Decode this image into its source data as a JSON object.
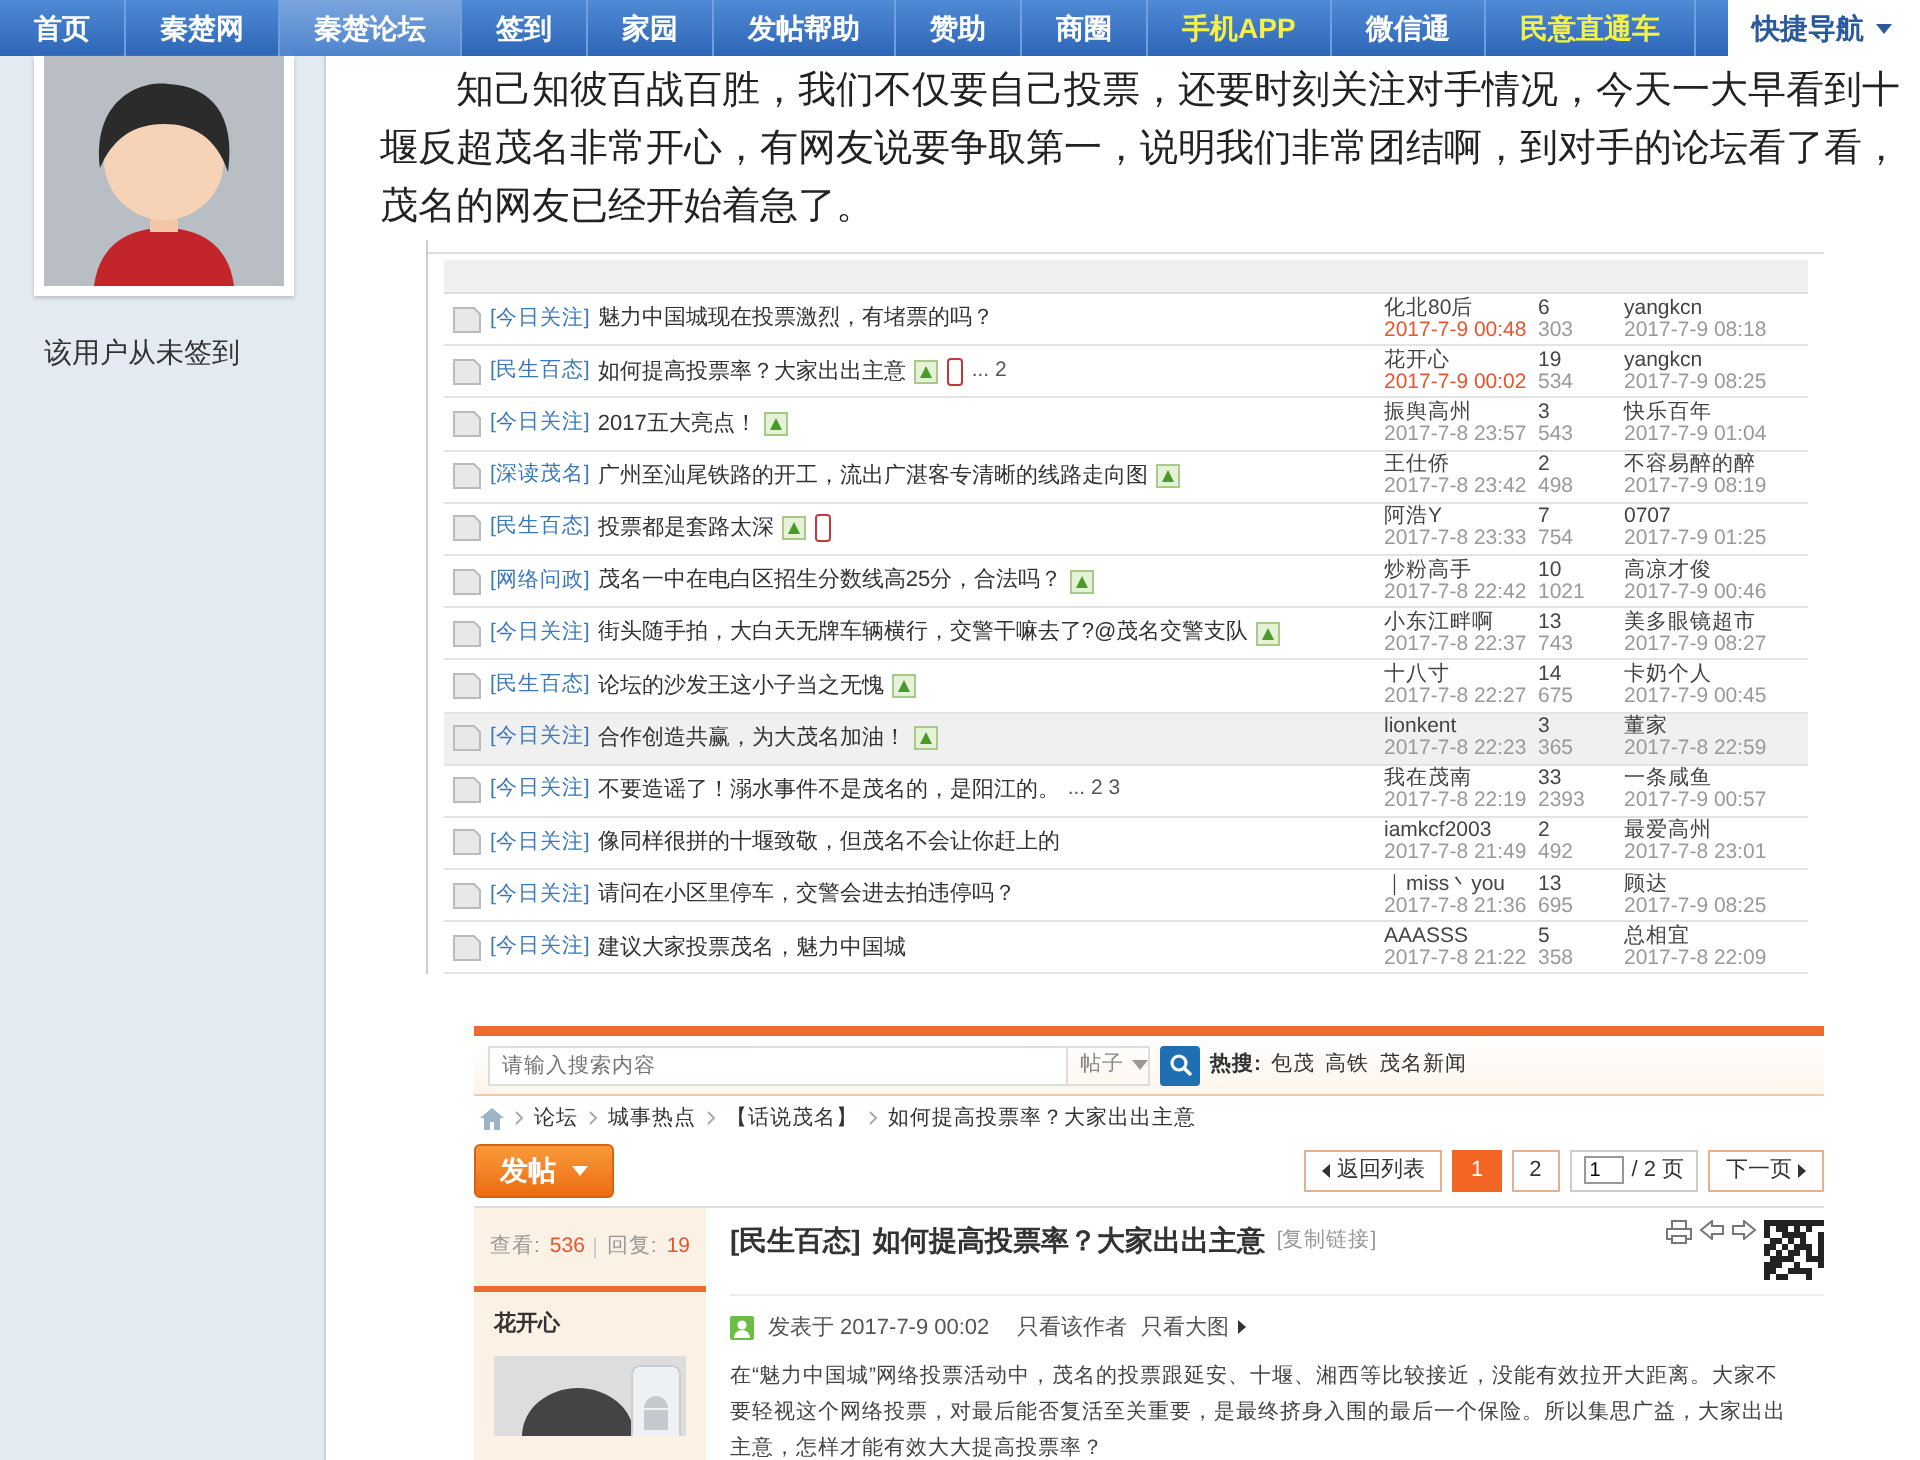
{
  "nav": {
    "items": [
      {
        "label": "首页",
        "selected": false,
        "kind": "normal"
      },
      {
        "label": "秦楚网",
        "selected": false,
        "kind": "normal"
      },
      {
        "label": "秦楚论坛",
        "selected": true,
        "kind": "normal"
      },
      {
        "label": "签到",
        "selected": false,
        "kind": "normal"
      },
      {
        "label": "家园",
        "selected": false,
        "kind": "normal"
      },
      {
        "label": "发帖帮助",
        "selected": false,
        "kind": "normal"
      },
      {
        "label": "赞助",
        "selected": false,
        "kind": "normal"
      },
      {
        "label": "商圈",
        "selected": false,
        "kind": "normal"
      },
      {
        "label": "手机APP",
        "selected": false,
        "kind": "promo"
      },
      {
        "label": "微信通",
        "selected": false,
        "kind": "normal"
      },
      {
        "label": "民意直通车",
        "selected": false,
        "kind": "promo"
      }
    ],
    "quick_nav": "快捷导航"
  },
  "sidebar": {
    "signin_status": "该用户从未签到"
  },
  "post": {
    "paragraph": "知己知彼百战百胜，我们不仅要自己投票，还要时刻关注对手情况，今天一大早看到十堰反超茂名非常开心，有网友说要争取第一，说明我们非常团结啊，到对手的论坛看了看，茂名的网友已经开始着急了。"
  },
  "forum_list_shot": {
    "threads": [
      {
        "tag": "[今日关注]",
        "title": "魅力中国城现在投票激烈，有堵票的吗？",
        "image": false,
        "mobile": false,
        "author": "化北80后",
        "date": "2017-7-9 00:48",
        "new": true,
        "replies": "6",
        "views": "303",
        "last_user": "yangkcn",
        "last_date": "2017-7-9 08:18",
        "selected": false
      },
      {
        "tag": "[民生百态]",
        "title": "如何提高投票率？大家出出主意",
        "image": true,
        "mobile": true,
        "pages": "... 2",
        "author": "花开心",
        "date": "2017-7-9 00:02",
        "new": true,
        "replies": "19",
        "views": "534",
        "last_user": "yangkcn",
        "last_date": "2017-7-9 08:25",
        "selected": false
      },
      {
        "tag": "[今日关注]",
        "title": "2017五大亮点！",
        "image": true,
        "mobile": false,
        "author": "振舆高州",
        "date": "2017-7-8 23:57",
        "new": false,
        "replies": "3",
        "views": "543",
        "last_user": "快乐百年",
        "last_date": "2017-7-9 01:04",
        "selected": false
      },
      {
        "tag": "[深读茂名]",
        "title": "广州至汕尾铁路的开工，流出广湛客专清晰的线路走向图",
        "image": true,
        "mobile": false,
        "author": "王仕侨",
        "date": "2017-7-8 23:42",
        "new": false,
        "replies": "2",
        "views": "498",
        "last_user": "不容易醉的醉",
        "last_date": "2017-7-9 08:19",
        "selected": false
      },
      {
        "tag": "[民生百态]",
        "title": "投票都是套路太深",
        "image": true,
        "mobile": true,
        "author": "阿浩Y",
        "date": "2017-7-8 23:33",
        "new": false,
        "replies": "7",
        "views": "754",
        "last_user": "0707",
        "last_date": "2017-7-9 01:25",
        "selected": false
      },
      {
        "tag": "[网络问政]",
        "title": "茂名一中在电白区招生分数线高25分，合法吗？",
        "image": true,
        "mobile": false,
        "author": "炒粉高手",
        "date": "2017-7-8 22:42",
        "new": false,
        "replies": "10",
        "views": "1021",
        "last_user": "高凉才俊",
        "last_date": "2017-7-9 00:46",
        "selected": false
      },
      {
        "tag": "[今日关注]",
        "title": "街头随手拍，大白天无牌车辆横行，交警干嘛去了?@茂名交警支队",
        "image": true,
        "mobile": false,
        "author": "小东江畔啊",
        "date": "2017-7-8 22:37",
        "new": false,
        "replies": "13",
        "views": "743",
        "last_user": "美多眼镜超市",
        "last_date": "2017-7-9 08:27",
        "selected": false
      },
      {
        "tag": "[民生百态]",
        "title": "论坛的沙发王这小子当之无愧",
        "image": true,
        "mobile": false,
        "author": "十八寸",
        "date": "2017-7-8 22:27",
        "new": false,
        "replies": "14",
        "views": "675",
        "last_user": "卡奶个人",
        "last_date": "2017-7-9 00:45",
        "selected": false
      },
      {
        "tag": "[今日关注]",
        "title": "合作创造共赢，为大茂名加油！",
        "image": true,
        "mobile": false,
        "author": "lionkent",
        "date": "2017-7-8 22:23",
        "new": false,
        "replies": "3",
        "views": "365",
        "last_user": "董家",
        "last_date": "2017-7-8 22:59",
        "selected": true
      },
      {
        "tag": "[今日关注]",
        "title": "不要造谣了！溺水事件不是茂名的，是阳江的。",
        "image": false,
        "mobile": false,
        "pages": "... 2 3",
        "author": "我在茂南",
        "date": "2017-7-8 22:19",
        "new": false,
        "replies": "33",
        "views": "2393",
        "last_user": "一条咸鱼",
        "last_date": "2017-7-9 00:57",
        "selected": false
      },
      {
        "tag": "[今日关注]",
        "title": "像同样很拼的十堰致敬，但茂名不会让你赶上的",
        "image": false,
        "mobile": false,
        "author": "iamkcf2003",
        "date": "2017-7-8 21:49",
        "new": false,
        "replies": "2",
        "views": "492",
        "last_user": "最爱高州",
        "last_date": "2017-7-8 23:01",
        "selected": false
      },
      {
        "tag": "[今日关注]",
        "title": "请问在小区里停车，交警会进去拍违停吗？",
        "image": false,
        "mobile": false,
        "author": "｜miss丶you",
        "date": "2017-7-8 21:36",
        "new": false,
        "replies": "13",
        "views": "695",
        "last_user": "顾达",
        "last_date": "2017-7-9 08:25",
        "selected": false
      },
      {
        "tag": "[今日关注]",
        "title": "建议大家投票茂名，魅力中国城",
        "image": false,
        "mobile": false,
        "author": "AAASSS",
        "date": "2017-7-8 21:22",
        "new": false,
        "replies": "5",
        "views": "358",
        "last_user": "总相宜",
        "last_date": "2017-7-8 22:09",
        "selected": false
      }
    ]
  },
  "thread_shot": {
    "search": {
      "placeholder": "请输入搜索内容",
      "scope": "帖子",
      "hot_label": "热搜:",
      "hot": [
        "包茂",
        "高铁",
        "茂名新闻"
      ]
    },
    "breadcrumb": [
      "论坛",
      "城事热点",
      "【话说茂名】",
      "如何提高投票率？大家出出主意"
    ],
    "post_button": "发帖",
    "pagination": {
      "back": "返回列表",
      "pages": [
        {
          "label": "1",
          "selected": true
        },
        {
          "label": "2",
          "selected": false
        }
      ],
      "page_input": "1",
      "total": "/ 2 页",
      "next": "下一页"
    },
    "stats": {
      "views_label": "查看:",
      "views": "536",
      "replies_label": "回复:",
      "replies": "19"
    },
    "title": {
      "tag": "[民生百态]",
      "text": "如何提高投票率？大家出出主意",
      "copy_link": "[复制链接]"
    },
    "author": "花开心",
    "meta": {
      "posted": "发表于 2017-7-9 00:02",
      "author_only": "只看该作者",
      "large_images": "只看大图"
    },
    "body": "在“魅力中国城”网络投票活动中，茂名的投票跟延安、十堰、湘西等比较接近，没能有效拉开大距离。大家不要轻视这个网络投票，对最后能否复活至关重要，是最终挤身入围的最后一个保险。所以集思广益，大家出出主意，怎样才能有效大大提高投票率？"
  }
}
